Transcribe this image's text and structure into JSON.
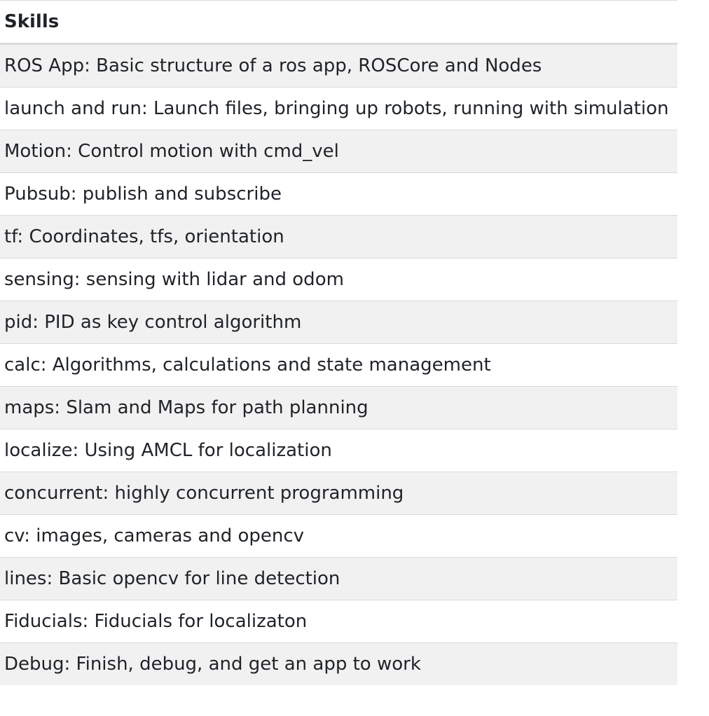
{
  "table": {
    "header": "Skills",
    "rows": [
      "ROS App: Basic structure of a ros app, ROSCore and Nodes",
      "launch and run: Launch files, bringing up robots, running with simulation",
      "Motion: Control motion with cmd_vel",
      "Pubsub: publish and subscribe",
      "tf: Coordinates, tfs, orientation",
      "sensing: sensing with lidar and odom",
      "pid: PID as key control algorithm",
      "calc: Algorithms, calculations and state management",
      "maps: Slam and Maps for path planning",
      "localize: Using AMCL for localization",
      "concurrent: highly concurrent programming",
      "cv: images, cameras and opencv",
      "lines: Basic opencv for line detection",
      "Fiducials: Fiducials for localizaton",
      "Debug: Finish, debug, and get an app to work"
    ]
  },
  "colors": {
    "text": "#1f2328",
    "stripe": "#f1f1f1",
    "border": "#d8dadd",
    "background": "#ffffff"
  }
}
